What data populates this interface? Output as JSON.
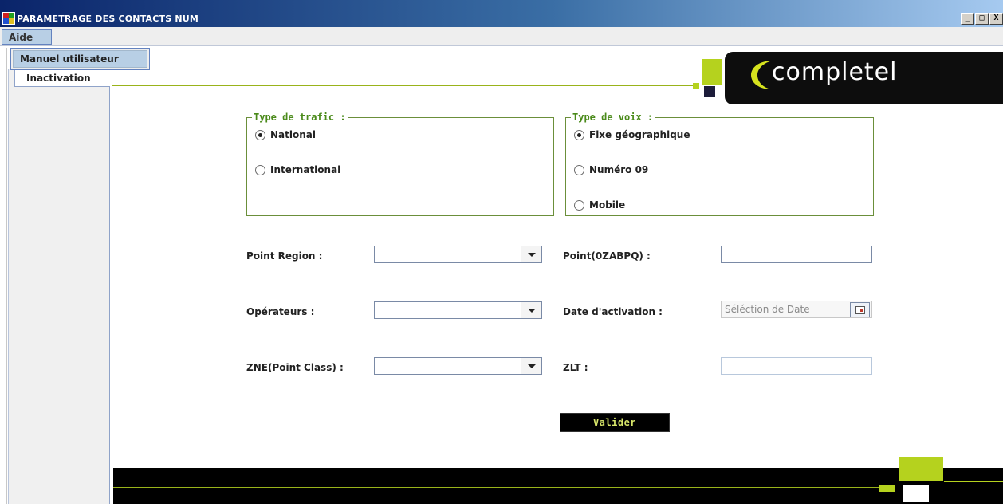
{
  "window": {
    "title": "PARAMETRAGE DES CONTACTS NUM",
    "buttons": {
      "minimize": "_",
      "maximize": "□",
      "close": "X"
    }
  },
  "menubar": {
    "aide_label": "Aide"
  },
  "menu_dropdown": {
    "items": [
      "Manuel utilisateur"
    ]
  },
  "tabs": [
    {
      "label": "Inactivation"
    }
  ],
  "logo": {
    "text": "completel"
  },
  "type_trafic": {
    "legend": "Type de trafic :",
    "options": [
      {
        "label": "National",
        "checked": true
      },
      {
        "label": "International",
        "checked": false
      }
    ]
  },
  "type_voix": {
    "legend": "Type de voix :",
    "options": [
      {
        "label": "Fixe géographique",
        "checked": true
      },
      {
        "label": "Numéro 09",
        "checked": false
      },
      {
        "label": "Mobile",
        "checked": false
      }
    ]
  },
  "form": {
    "point_region_label": "Point Region :",
    "point_region_value": "",
    "point_0zabpq_label": "Point(0ZABPQ) :",
    "point_0zabpq_value": "",
    "operateurs_label": "Opérateurs :",
    "operateurs_value": "",
    "date_activation_label": "Date d'activation :",
    "date_activation_placeholder": "Séléction de Date",
    "zne_label": "ZNE(Point Class) :",
    "zne_value": "",
    "zlt_label": "ZLT :",
    "zlt_value": ""
  },
  "actions": {
    "valider_label": "Valider"
  },
  "colors": {
    "accent_green": "#b5d21e",
    "legend_green": "#4a8a1a",
    "title_bar": "#0a246a",
    "menu_highlight": "#b8cfe5"
  }
}
